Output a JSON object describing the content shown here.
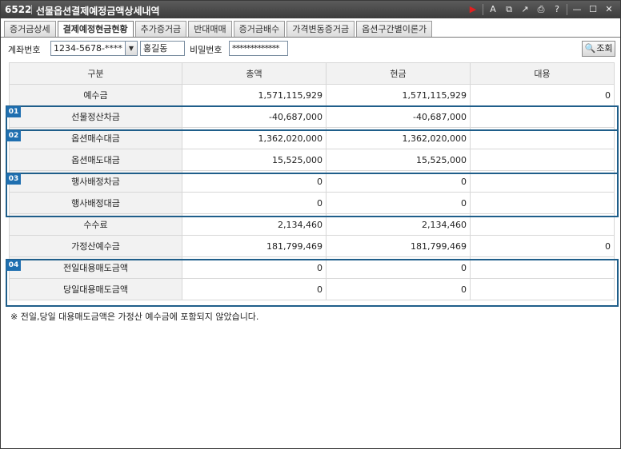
{
  "window": {
    "code": "6522",
    "title": "선물옵션결제예정금액상세내역"
  },
  "toolbar_icons": [
    {
      "name": "play-icon",
      "glyph": "▶"
    },
    {
      "name": "font-icon",
      "glyph": "A"
    },
    {
      "name": "link-icon",
      "glyph": "⧉"
    },
    {
      "name": "expand-icon",
      "glyph": "↗"
    },
    {
      "name": "print-icon",
      "glyph": "⎙"
    },
    {
      "name": "help-icon",
      "glyph": "?"
    },
    {
      "name": "minimize-icon",
      "glyph": "—"
    },
    {
      "name": "maximize-icon",
      "glyph": "☐"
    },
    {
      "name": "close-icon",
      "glyph": "✕"
    }
  ],
  "tabs": [
    "증거금상세",
    "결제예정현금현황",
    "추가증거금",
    "반대매매",
    "증거금배수",
    "가격변동증거금",
    "옵션구간별이론가"
  ],
  "active_tab": 1,
  "query": {
    "account_label": "계좌번호",
    "account_value": "1234-5678-****",
    "name_value": "홍길동",
    "password_label": "비밀번호",
    "password_value": "*************",
    "search_label": "조회"
  },
  "table": {
    "headers": [
      "구분",
      "총액",
      "현금",
      "대용"
    ],
    "rows": [
      {
        "label": "예수금",
        "total": "1,571,115,929",
        "cash": "1,571,115,929",
        "sub": "0"
      },
      {
        "label": "선물정산차금",
        "total": "-40,687,000",
        "cash": "-40,687,000",
        "sub": ""
      },
      {
        "label": "옵션매수대금",
        "total": "1,362,020,000",
        "cash": "1,362,020,000",
        "sub": ""
      },
      {
        "label": "옵션매도대금",
        "total": "15,525,000",
        "cash": "15,525,000",
        "sub": ""
      },
      {
        "label": "행사배정차금",
        "total": "0",
        "cash": "0",
        "sub": ""
      },
      {
        "label": "행사배정대금",
        "total": "0",
        "cash": "0",
        "sub": ""
      },
      {
        "label": "수수료",
        "total": "2,134,460",
        "cash": "2,134,460",
        "sub": ""
      },
      {
        "label": "가정산예수금",
        "total": "181,799,469",
        "cash": "181,799,469",
        "sub": "0"
      },
      {
        "label": "전일대용매도금액",
        "total": "0",
        "cash": "0",
        "sub": ""
      },
      {
        "label": "당일대용매도금액",
        "total": "0",
        "cash": "0",
        "sub": ""
      }
    ]
  },
  "badges": [
    "01",
    "02",
    "03",
    "04"
  ],
  "note": "※ 전일,당일 대용매도금액은 가정산 예수금에 포함되지 않았습니다.",
  "colors": {
    "badge": "#1f6fb0",
    "group_border": "#1f5e8a",
    "titlebar": "#4a4a4a"
  }
}
